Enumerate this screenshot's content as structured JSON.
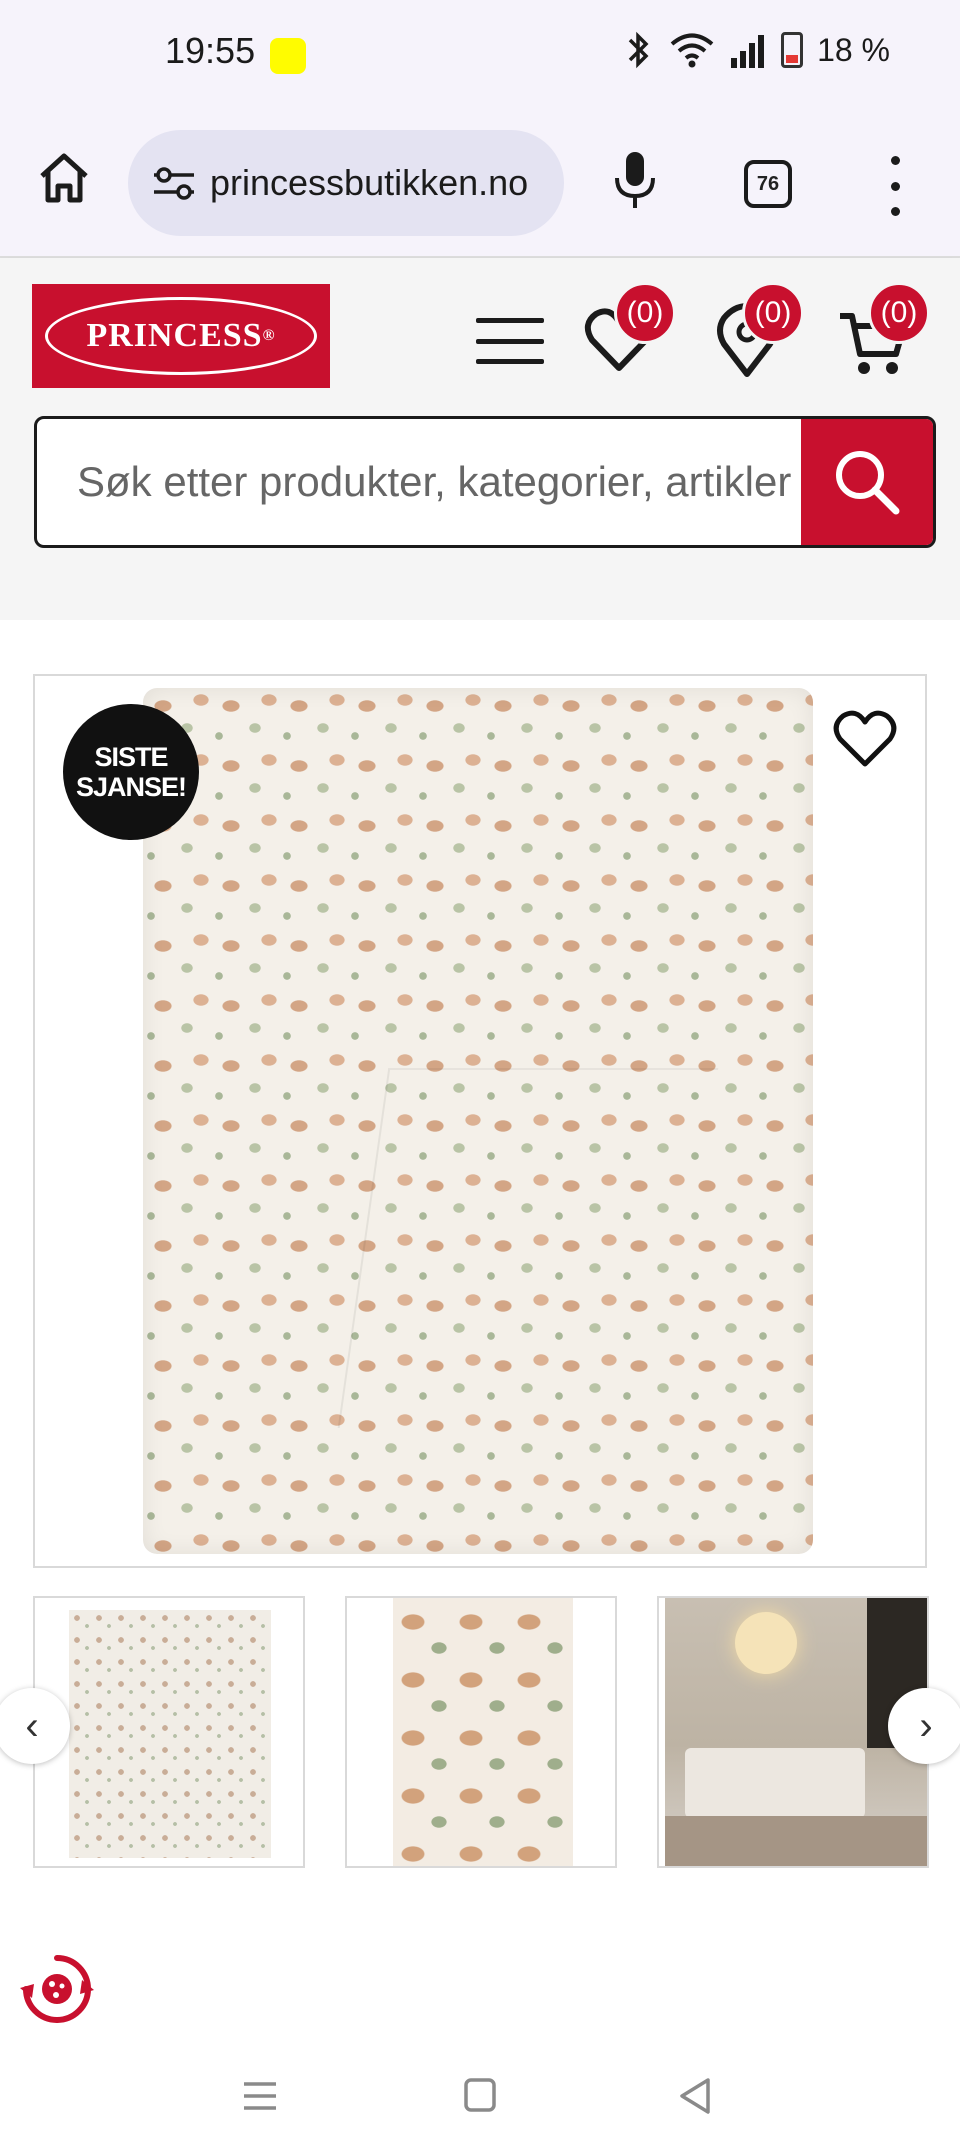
{
  "status_bar": {
    "time": "19:55",
    "battery": "18 %"
  },
  "browser": {
    "url": "princessbutikken.no",
    "tab_count": "76"
  },
  "site": {
    "logo_text": "PRINCESS",
    "logo_mark": "®",
    "wishlist_count": "(0)",
    "stores_count": "(0)",
    "cart_count": "(0)",
    "search_placeholder": "Søk etter produkter, kategorier, artikler"
  },
  "product": {
    "sale_badge_line1": "SISTE",
    "sale_badge_line2": "SJANSE!"
  },
  "carousel": {
    "prev": "‹",
    "next": "›"
  },
  "colors": {
    "brand_red": "#c8102e",
    "header_bg": "#f5f5f5",
    "status_bg": "#f6f3fb"
  },
  "icons": [
    "home-icon",
    "tune-icon",
    "mic-icon",
    "tabs-icon",
    "kebab-menu-icon",
    "hamburger-menu-icon",
    "heart-icon",
    "location-pin-icon",
    "cart-icon",
    "search-icon",
    "favorite-heart-icon",
    "cookie-settings-icon"
  ]
}
